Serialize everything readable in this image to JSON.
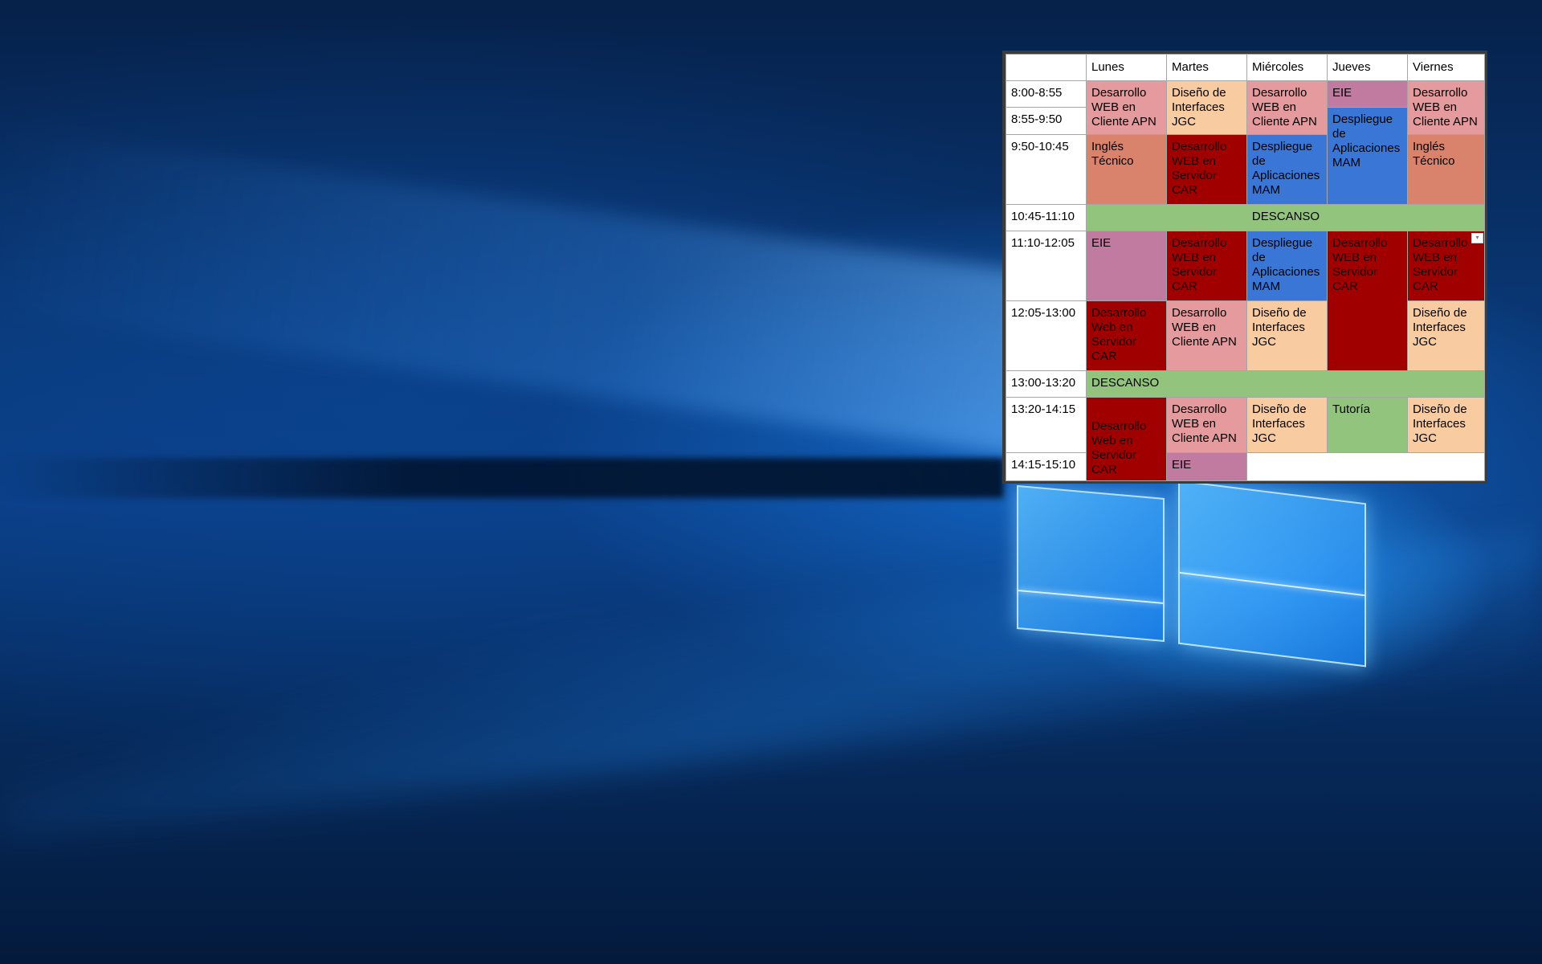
{
  "colors": {
    "pink": "#e59b9d",
    "peach": "#f8cba1",
    "salmon": "#d9826c",
    "dark_red": "#a00000",
    "blue": "#3a76d6",
    "mauve": "#c27ba0",
    "green": "#93c47d",
    "white": "#ffffff"
  },
  "schedule": {
    "days": [
      "Lunes",
      "Martes",
      "Miércoles",
      "Jueves",
      "Viernes"
    ],
    "times": [
      "8:00-8:55",
      "8:55-9:50",
      "9:50-10:45",
      "10:45-11:10",
      "11:10-12:05",
      "12:05-13:00",
      "13:00-13:20",
      "13:20-14:15",
      "14:15-15:10"
    ],
    "cells": {
      "dwc_apn": [
        "Desarrollo",
        "WEB en",
        "Cliente APN"
      ],
      "di_jgc": [
        "Diseño de",
        "Interfaces",
        "JGC"
      ],
      "eie": "EIE",
      "daw_mam": [
        "Despliegue",
        "de",
        "Aplicaciones",
        "MAM"
      ],
      "ingles": [
        "Inglés",
        "Técnico"
      ],
      "dws_car_upper": [
        "Desarrollo",
        "WEB en",
        "Servidor",
        "CAR"
      ],
      "dws_car_lower": [
        "Desarrollo",
        "Web en",
        "Servidor",
        "CAR"
      ],
      "descanso": "DESCANSO",
      "tutoria": "Tutoría"
    }
  }
}
